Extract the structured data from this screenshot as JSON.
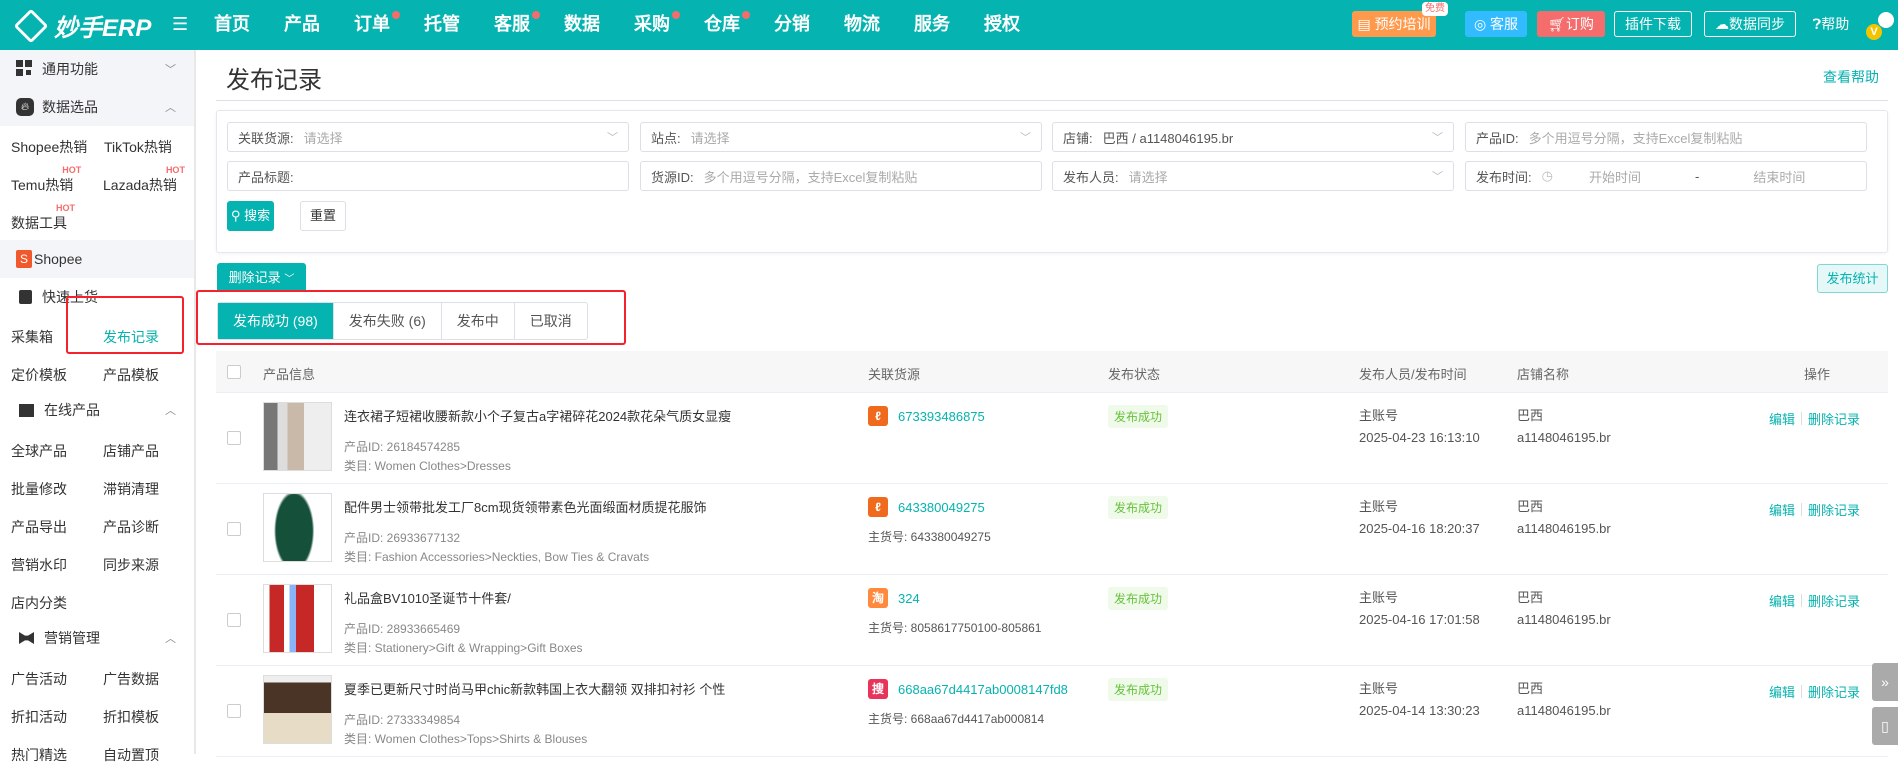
{
  "topbar": {
    "brand": "妙手ERP",
    "nav": [
      {
        "label": "首页",
        "dot": false
      },
      {
        "label": "产品",
        "dot": false
      },
      {
        "label": "订单",
        "dot": true
      },
      {
        "label": "托管",
        "dot": false
      },
      {
        "label": "客服",
        "dot": true
      },
      {
        "label": "数据",
        "dot": false
      },
      {
        "label": "采购",
        "dot": true
      },
      {
        "label": "仓库",
        "dot": true
      },
      {
        "label": "分销",
        "dot": false
      },
      {
        "label": "物流",
        "dot": false
      },
      {
        "label": "服务",
        "dot": false
      },
      {
        "label": "授权",
        "dot": false
      }
    ],
    "training": "预约培训",
    "free_badge": "免费",
    "service": "客服",
    "order": "订购",
    "plugin": "插件下载",
    "sync": "数据同步",
    "help": "帮助",
    "vip": "V",
    "colors": {
      "brand": "#05b3b0",
      "training": "#ff9a4d",
      "service": "#33bbff",
      "order": "#f56c6c"
    }
  },
  "sidebar": {
    "groups": {
      "general": "通用功能",
      "data_select": "数据选品",
      "shopee": "Shopee",
      "quick_upload": "快速上货",
      "online": "在线产品",
      "marketing": "营销管理"
    },
    "hot": "HOT",
    "data_items": [
      "Shopee热销",
      "TikTok热销",
      "Temu热销",
      "Lazada热销",
      "数据工具"
    ],
    "quick_items": [
      "采集箱",
      "发布记录",
      "定价模板",
      "产品模板"
    ],
    "online_items": [
      "全球产品",
      "店铺产品",
      "批量修改",
      "滞销清理",
      "产品导出",
      "产品诊断",
      "营销水印",
      "同步来源",
      "店内分类"
    ],
    "marketing_items": [
      "广告活动",
      "广告数据",
      "折扣活动",
      "折扣模板",
      "热门精选",
      "自动置顶"
    ]
  },
  "page": {
    "title": "发布记录",
    "help_link": "查看帮助"
  },
  "filters": {
    "source": {
      "label": "关联货源:",
      "placeholder": "请选择"
    },
    "site": {
      "label": "站点:",
      "placeholder": "请选择"
    },
    "shop": {
      "label": "店铺:",
      "value": "巴西 / a1148046195.br"
    },
    "product_id": {
      "label": "产品ID:",
      "placeholder": "多个用逗号分隔，支持Excel复制粘贴"
    },
    "product_title": {
      "label": "产品标题:"
    },
    "source_id": {
      "label": "货源ID:",
      "placeholder": "多个用逗号分隔，支持Excel复制粘贴"
    },
    "publisher": {
      "label": "发布人员:",
      "placeholder": "请选择"
    },
    "publish_time": {
      "label": "发布时间:",
      "start": "开始时间",
      "sep": "-",
      "end": "结束时间"
    },
    "search": "搜索",
    "reset": "重置"
  },
  "actions": {
    "delete_records": "删除记录",
    "publish_stats": "发布统计"
  },
  "tabs": [
    {
      "label": "发布成功 (98)",
      "active": true
    },
    {
      "label": "发布失败 (6)",
      "active": false
    },
    {
      "label": "发布中",
      "active": false
    },
    {
      "label": "已取消",
      "active": false
    }
  ],
  "table": {
    "headers": {
      "product": "产品信息",
      "source": "关联货源",
      "status": "发布状态",
      "publisher": "发布人员/发布时间",
      "shop": "店铺名称",
      "ops": "操作"
    },
    "edit": "编辑",
    "delete": "删除记录",
    "rows": [
      {
        "title": "连衣裙子短裙收腰新款小个子复古a字裙碎花2024款花朵气质女显瘦",
        "pid": "产品ID: 26184574285",
        "cat": "类目: Women Clothes>Dresses",
        "src_icon": "1688",
        "src_id": "673393486875",
        "main_no": "",
        "status": "发布成功",
        "person": "主账号",
        "time": "2025-04-23 16:13:10",
        "shop_region": "巴西",
        "shop_name": "a1148046195.br"
      },
      {
        "title": "配件男士领带批发工厂8cm现货领带素色光面缎面材质提花服饰",
        "pid": "产品ID: 26933677132",
        "cat": "类目: Fashion Accessories>Neckties, Bow Ties & Cravats",
        "src_icon": "1688",
        "src_id": "643380049275",
        "main_no": "主货号: 643380049275",
        "status": "发布成功",
        "person": "主账号",
        "time": "2025-04-16 18:20:37",
        "shop_region": "巴西",
        "shop_name": "a1148046195.br"
      },
      {
        "title": "礼品盒BV1010圣诞节十件套/",
        "pid": "产品ID: 28933665469",
        "cat": "类目: Stationery>Gift & Wrapping>Gift Boxes",
        "src_icon": "taobao",
        "src_id": "324",
        "main_no": "主货号: 8058617750100-805861",
        "status": "发布成功",
        "person": "主账号",
        "time": "2025-04-16 17:01:58",
        "shop_region": "巴西",
        "shop_name": "a1148046195.br"
      },
      {
        "title": "夏季已更新尺寸时尚马甲chic新款韩国上衣大翻领 双排扣衬衫 个性",
        "pid": "产品ID: 27333349854",
        "cat": "类目: Women Clothes>Tops>Shirts & Blouses",
        "src_icon": "sou",
        "src_id": "668aa67d4417ab0008147fd8",
        "main_no": "主货号: 668aa67d4417ab000814",
        "status": "发布成功",
        "person": "主账号",
        "time": "2025-04-14 13:30:23",
        "shop_region": "巴西",
        "shop_name": "a1148046195.br"
      }
    ]
  }
}
